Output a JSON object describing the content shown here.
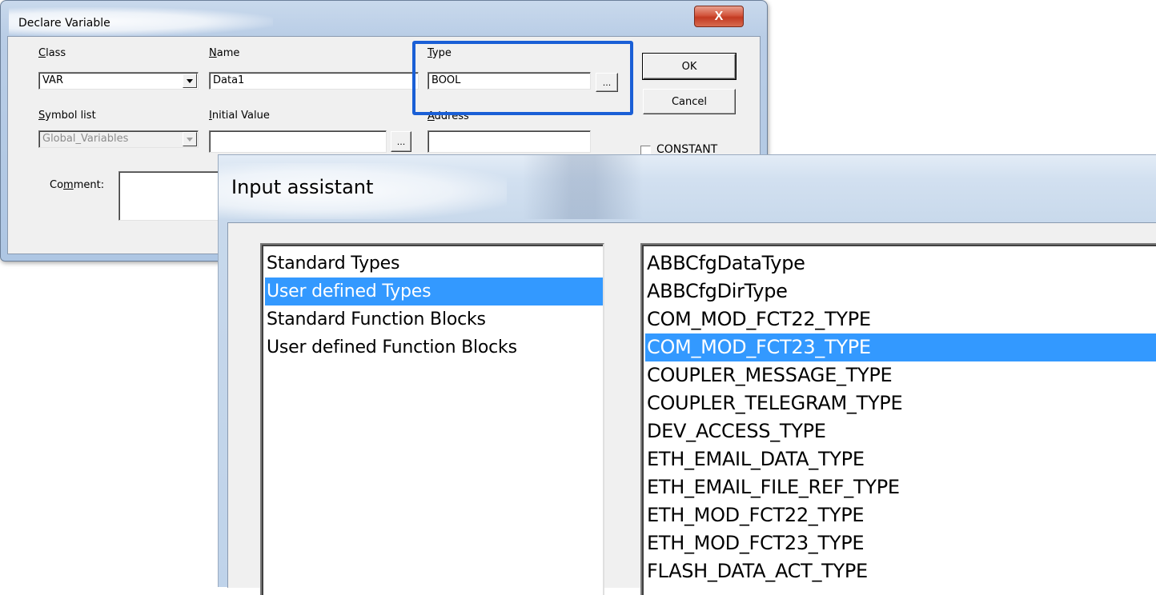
{
  "declare_variable": {
    "title": "Declare Variable",
    "close_label": "X",
    "class": {
      "label_prefix": "",
      "label_underlined": "C",
      "label_rest": "lass",
      "value": "VAR"
    },
    "name": {
      "label_underlined": "N",
      "label_rest": "ame",
      "value": "Data1"
    },
    "type": {
      "label_underlined": "T",
      "label_rest": "ype",
      "value": "BOOL",
      "browse_label": "..."
    },
    "symbol_list": {
      "label_underlined": "S",
      "label_rest": "ymbol list",
      "value": "Global_Variables"
    },
    "initial_value": {
      "label_underlined": "I",
      "label_rest": "nitial Value",
      "value": "",
      "browse_label": "..."
    },
    "address": {
      "label_underlined": "A",
      "label_rest": "ddress",
      "value": ""
    },
    "comment": {
      "label_prefix": "Co",
      "label_underlined": "m",
      "label_rest": "ment:",
      "value": ""
    },
    "ok_label": "OK",
    "cancel_label": "Cancel",
    "constant_label": "CONSTANT",
    "constant_checked": false,
    "highlight_color": "#1a5fd6"
  },
  "input_assistant": {
    "title": "Input assistant",
    "categories": [
      {
        "label": "Standard Types",
        "selected": false
      },
      {
        "label": "User defined Types",
        "selected": true
      },
      {
        "label": "Standard Function Blocks",
        "selected": false
      },
      {
        "label": "User defined Function Blocks",
        "selected": false
      }
    ],
    "types": [
      {
        "label": "ABBCfgDataType",
        "selected": false
      },
      {
        "label": "ABBCfgDirType",
        "selected": false
      },
      {
        "label": "COM_MOD_FCT22_TYPE",
        "selected": false
      },
      {
        "label": "COM_MOD_FCT23_TYPE",
        "selected": true
      },
      {
        "label": "COUPLER_MESSAGE_TYPE",
        "selected": false
      },
      {
        "label": "COUPLER_TELEGRAM_TYPE",
        "selected": false
      },
      {
        "label": "DEV_ACCESS_TYPE",
        "selected": false
      },
      {
        "label": "ETH_EMAIL_DATA_TYPE",
        "selected": false
      },
      {
        "label": "ETH_EMAIL_FILE_REF_TYPE",
        "selected": false
      },
      {
        "label": "ETH_MOD_FCT22_TYPE",
        "selected": false
      },
      {
        "label": "ETH_MOD_FCT23_TYPE",
        "selected": false
      },
      {
        "label": "FLASH_DATA_ACT_TYPE",
        "selected": false
      }
    ],
    "selection_color": "#3399ff"
  }
}
